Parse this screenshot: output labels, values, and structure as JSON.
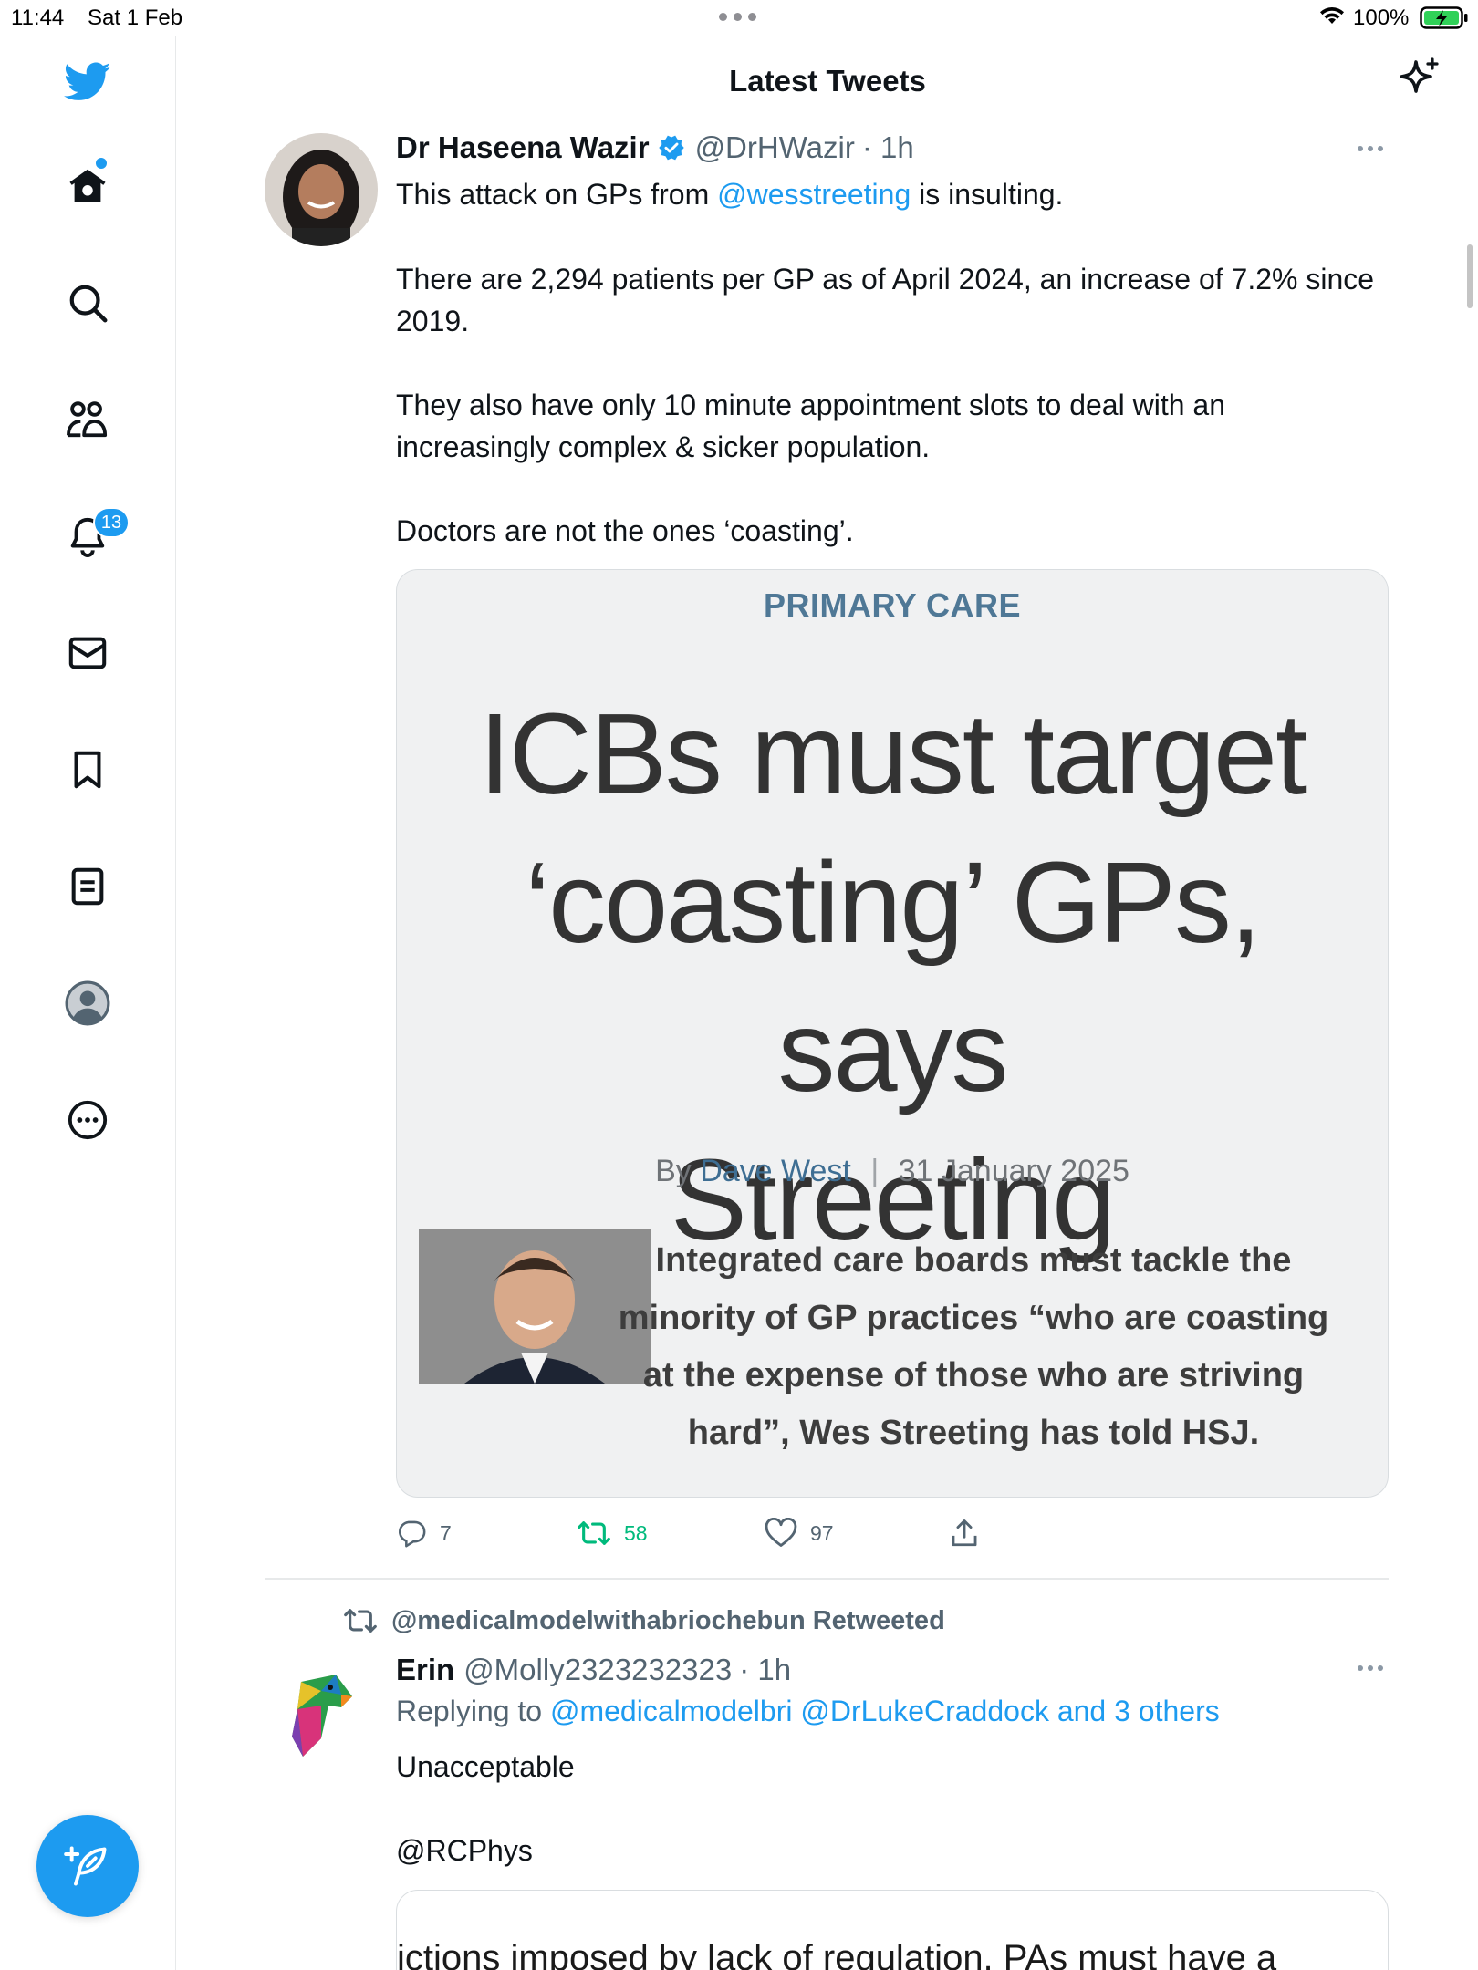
{
  "status_bar": {
    "time": "11:44",
    "date": "Sat 1 Feb",
    "battery": "100%"
  },
  "header": {
    "title": "Latest Tweets"
  },
  "sidebar": {
    "notifications_badge": "13"
  },
  "tweet1": {
    "name": "Dr Haseena Wazir",
    "handle": "@DrHWazir",
    "time": "· 1h",
    "text_prefix": "This attack on GPs from",
    "mention": "@wesstreeting",
    "text_suffix": "is insulting.",
    "para2": "There are 2,294 patients per GP as of April 2024, an increase of 7.2% since 2019.",
    "para3": "They also have only 10 minute appointment slots to deal with an increasingly complex & sicker population.",
    "para4": "Doctors are not the ones ‘coasting’.",
    "card": {
      "category": "PRIMARY CARE",
      "headline_line1": "ICBs must target",
      "headline_line2": "‘coasting’ GPs, says",
      "headline_line3": "Streeting",
      "by": "By",
      "author": "Dave West",
      "date": "31 January 2025",
      "summary": "Integrated care boards must tackle the minority of GP practices “who are coasting at the expense of those who are striving hard”, Wes Streeting has told HSJ."
    },
    "replies": "7",
    "retweets": "58",
    "likes": "97"
  },
  "tweet2": {
    "retweeted_by": "@medicalmodelwithabriochebun Retweeted",
    "name": "Erin",
    "handle": "@Molly2323232323",
    "time": "· 1h",
    "replying_label": "Replying to",
    "replying_to": "@medicalmodelbri @DrLukeCraddock and 3 others",
    "text1": "Unacceptable",
    "text2": "@RCPhys",
    "quote_snippet": "ictions imposed by lack of regulation. PAs must have a"
  },
  "colors": {
    "accent": "#1d9bf0",
    "retweet_green": "#00ba7c",
    "secondary_text": "#536471"
  }
}
